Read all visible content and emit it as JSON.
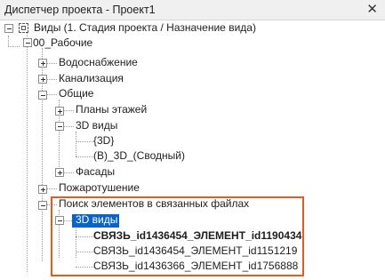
{
  "window": {
    "title": "Диспетчер проекта - Проект1",
    "close_glyph": "✕"
  },
  "tree": {
    "root": "Виды (1. Стадия проекта / Назначение вида)",
    "group": "00_Рабочие",
    "n_water": "Водоснабжение",
    "n_sewer": "Канализация",
    "n_general": "Общие",
    "n_floorplans": "Планы этажей",
    "n_3d_general": "3D виды",
    "n_3d_item": "{3D}",
    "n_3d_combined": "(В)_3D_(Сводный)",
    "n_facades": "Фасады",
    "n_fire": "Пожаротушение",
    "n_search": "Поиск элементов в связанных файлах",
    "n_3d_search": "3D виды",
    "link_items": [
      "СВЯЗЬ_id1436454_ЭЛЕМЕНТ_id1190434",
      "СВЯЗЬ_id1436454_ЭЛЕМЕНТ_id1151219",
      "СВЯЗЬ_id1436366_ЭЛЕМЕНТ_id1756888"
    ]
  },
  "colors": {
    "selection": "#0a64c8",
    "highlight_border": "#e55a1f"
  }
}
